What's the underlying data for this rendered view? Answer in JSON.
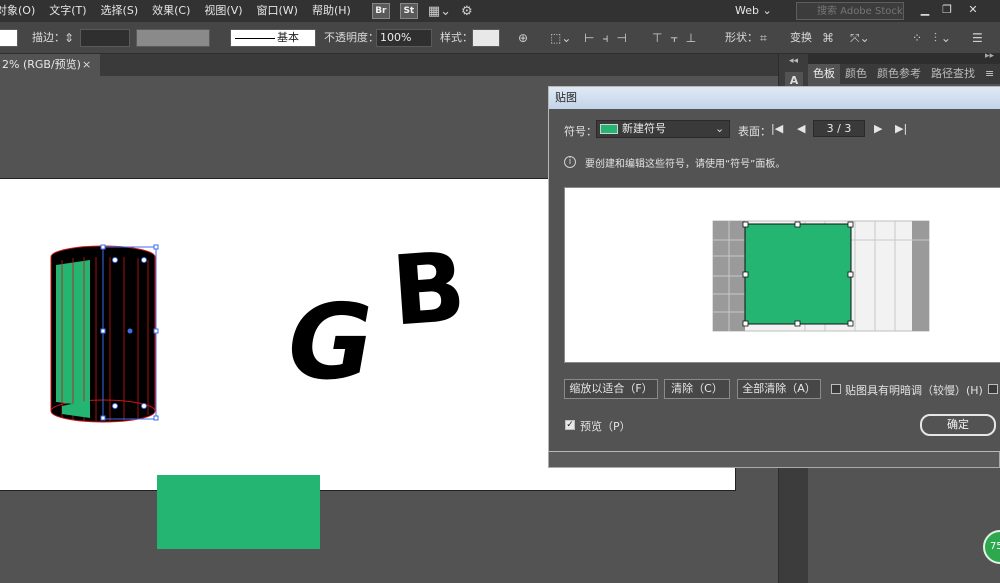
{
  "menu": [
    "对象(O)",
    "文字(T)",
    "选择(S)",
    "效果(C)",
    "视图(V)",
    "窗口(W)",
    "帮助(H)"
  ],
  "app_buttons": [
    "Br",
    "St"
  ],
  "workspace": "Web",
  "stock_search_placeholder": "搜索 Adobe Stock",
  "control_bar": {
    "stroke_label": "描边：",
    "stroke_style": "基本",
    "opacity_label": "不透明度：",
    "opacity_value": "100%",
    "style_label": "样式：",
    "shape_label": "形状：",
    "transform_label": "变换"
  },
  "document_tab": {
    "label": "2% (RGB/预览)",
    "close": "×"
  },
  "panel_tabs": [
    "色板",
    "颜色",
    "颜色参考",
    "路径查找"
  ],
  "panel_menu": "≡",
  "canvas": {
    "letter_g": "G",
    "letter_b": "B"
  },
  "dialog": {
    "title": "贴图",
    "symbol_label": "符号：",
    "symbol_name": "新建符号",
    "surface_label": "表面：",
    "surface_value": "3 / 3",
    "info_text": "要创建和编辑这些符号，请使用“符号”面板。",
    "buttons": {
      "fit": "缩放以适合（F）",
      "clear": "清除（C）",
      "clear_all": "全部清除（A）"
    },
    "shade_label": "贴图具有明暗调（较慢）(H)",
    "preview_label": "预览（P）",
    "preview_checked": true,
    "ok": "确定"
  },
  "badge": "75",
  "colors": {
    "accent_green": "#24b573",
    "ui_dark": "#323232",
    "ui_mid": "#535353"
  }
}
